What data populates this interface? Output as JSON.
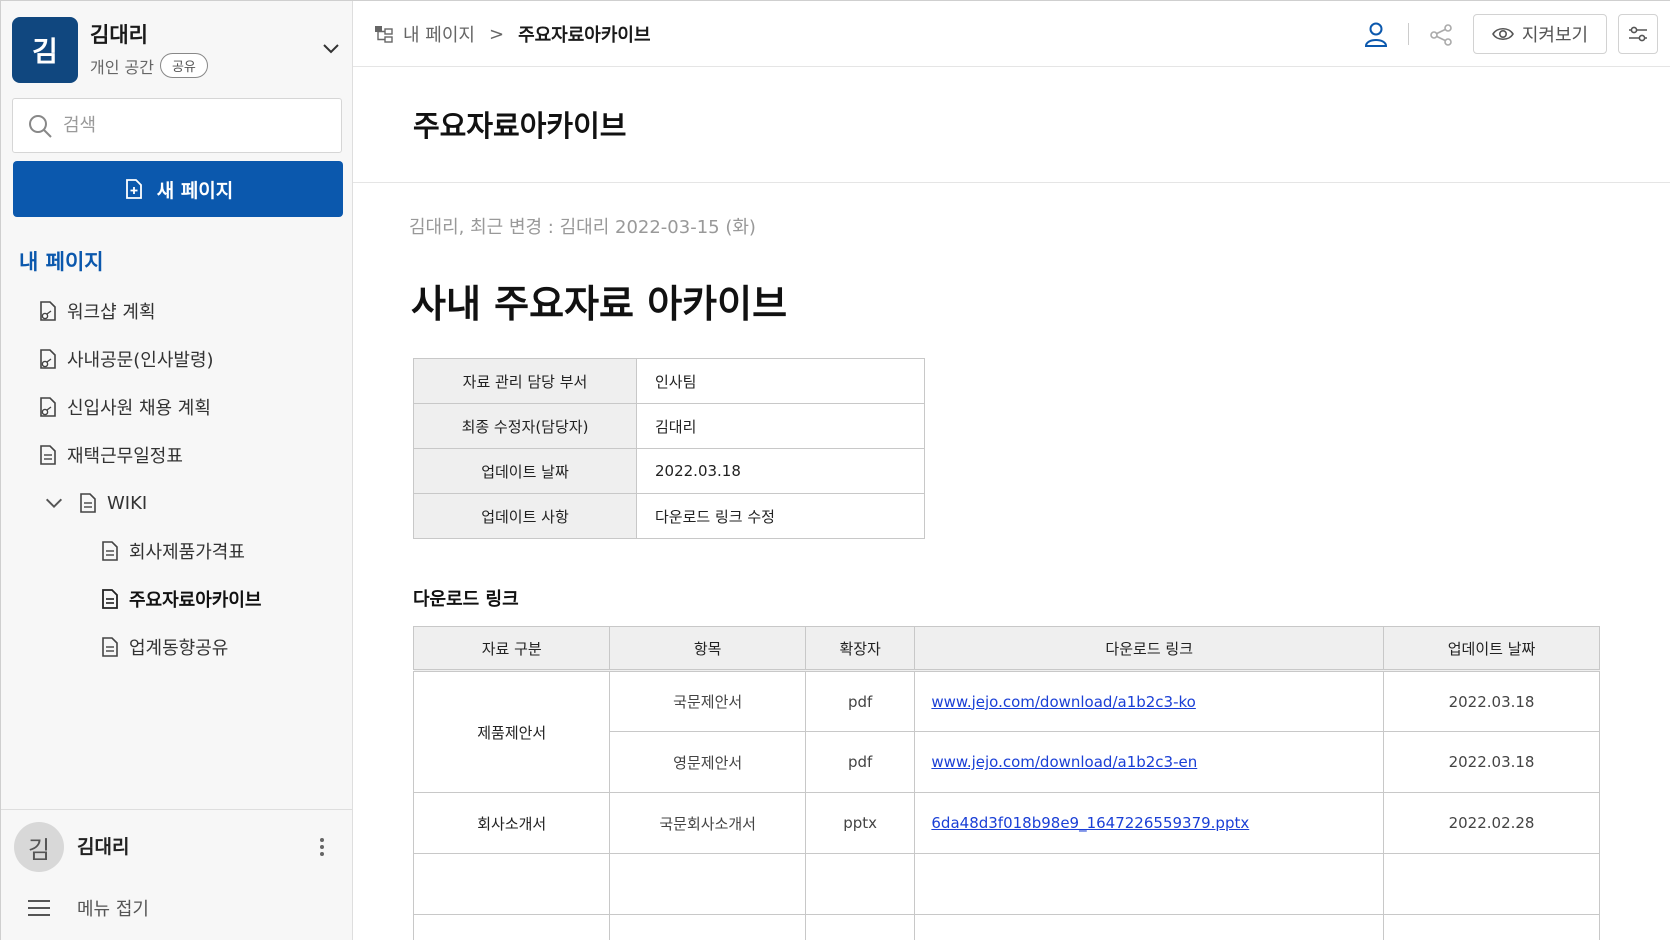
{
  "workspace": {
    "avatar_letter": "김",
    "name": "김대리",
    "subtitle": "개인 공간",
    "badge": "공유"
  },
  "search": {
    "placeholder": "검색"
  },
  "new_page_label": "새 페이지",
  "sidebar": {
    "section_title": "내 페이지",
    "items": [
      {
        "label": "워크샵 계획",
        "icon": "shared-doc-icon"
      },
      {
        "label": "사내공문(인사발령)",
        "icon": "shared-doc-icon"
      },
      {
        "label": "신입사원 채용 계획",
        "icon": "shared-doc-icon"
      },
      {
        "label": "재택근무일정표",
        "icon": "document-icon"
      },
      {
        "label": "WIKI",
        "icon": "document-icon",
        "expanded": true
      },
      {
        "label": "회사제품가격표",
        "icon": "document-icon"
      },
      {
        "label": "주요자료아카이브",
        "icon": "document-icon",
        "active": true
      },
      {
        "label": "업계동향공유",
        "icon": "document-icon"
      }
    ]
  },
  "user": {
    "avatar_letter": "김",
    "name": "김대리"
  },
  "collapse_label": "메뉴 접기",
  "breadcrumb": {
    "parent": "내 페이지",
    "current": "주요자료아카이브"
  },
  "toolbar": {
    "watch_label": "지켜보기"
  },
  "page": {
    "title": "주요자료아카이브",
    "meta": "김대리, 최근 변경 : 김대리 2022-03-15 (화)",
    "heading": "사내 주요자료 아카이브"
  },
  "info_table": [
    {
      "key": "자료 관리 담당 부서",
      "value": "인사팀"
    },
    {
      "key": "최종 수정자(담당자)",
      "value": "김대리"
    },
    {
      "key": "업데이트 날짜",
      "value": "2022.03.18"
    },
    {
      "key": "업데이트 사항",
      "value": "다운로드 링크 수정"
    }
  ],
  "downloads": {
    "title": "다운로드 링크",
    "headers": [
      "자료 구분",
      "항목",
      "확장자",
      "다운로드 링크",
      "업데이트 날짜"
    ],
    "rows": [
      {
        "category": "제품제안서",
        "item": "국문제안서",
        "ext": "pdf",
        "link": "www.jejo.com/download/a1b2c3-ko",
        "date": "2022.03.18"
      },
      {
        "category": "",
        "item": "영문제안서",
        "ext": "pdf",
        "link": "www.jejo.com/download/a1b2c3-en",
        "date": "2022.03.18"
      },
      {
        "category": "회사소개서",
        "item": "국문회사소개서",
        "ext": "pptx",
        "link": "6da48d3f018b98e9_1647226559379.pptx",
        "date": "2022.02.28"
      }
    ]
  },
  "colors": {
    "brand": "#0b58ad",
    "workspace_avatar": "#10477f",
    "link": "#1a3fd6"
  }
}
